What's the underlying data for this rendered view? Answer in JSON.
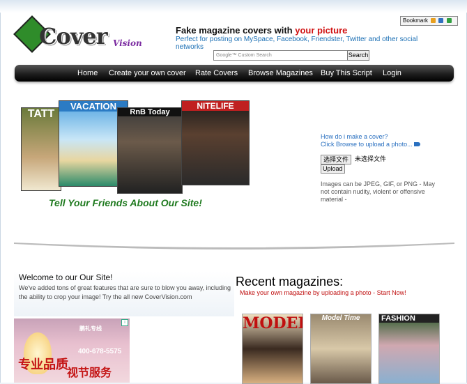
{
  "bookmark": {
    "label": "Bookmark"
  },
  "logo": {
    "main": "Cover",
    "sub": "Vision"
  },
  "header": {
    "tagline_prefix": "Fake magazine covers with ",
    "tagline_highlight": "your picture",
    "subtagline": "Perfect for posting on MySpace, Facebook, Friendster, Twitter and other social networks"
  },
  "search": {
    "placeholder": "Google™ Custom Search",
    "button": "Search"
  },
  "nav": [
    "Home",
    "Create your own cover",
    "Rate Covers",
    "Browse Magazines",
    "Buy This Script",
    "Login"
  ],
  "covers": {
    "titles": [
      "TATT",
      "VACATION",
      "RnB Today",
      "NITELIFE"
    ],
    "colors": [
      "#7a8a3a",
      "#2b7bc4",
      "#222222",
      "#1a1a1a"
    ]
  },
  "tell_friends": "Tell Your Friends About Our Site!",
  "upload": {
    "how_question": "How do i make a cover?",
    "how_instruction": "Click Browse to upload a photo...",
    "choose_file": "选择文件",
    "no_file": "未选择文件",
    "upload_button": "Upload",
    "note": "Images can be JPEG, GIF, or PNG - May not contain nudity, violent or offensive material -"
  },
  "welcome": {
    "title": "Welcome to our Our Site!",
    "body": "We've added tons of great features that are sure to blow you away, including the ability to crop your image! Try the all new CoverVision.com"
  },
  "ad": {
    "logo": "鹏礼专线",
    "phone": "400-678-5575",
    "line1": "专业品质",
    "line2": "视节服务"
  },
  "recent": {
    "title": "Recent magazines:",
    "subtitle": "Make your own magazine by uploading a photo - Start Now!",
    "mags": [
      "MODEL",
      "Model Time",
      "FASHION"
    ]
  }
}
